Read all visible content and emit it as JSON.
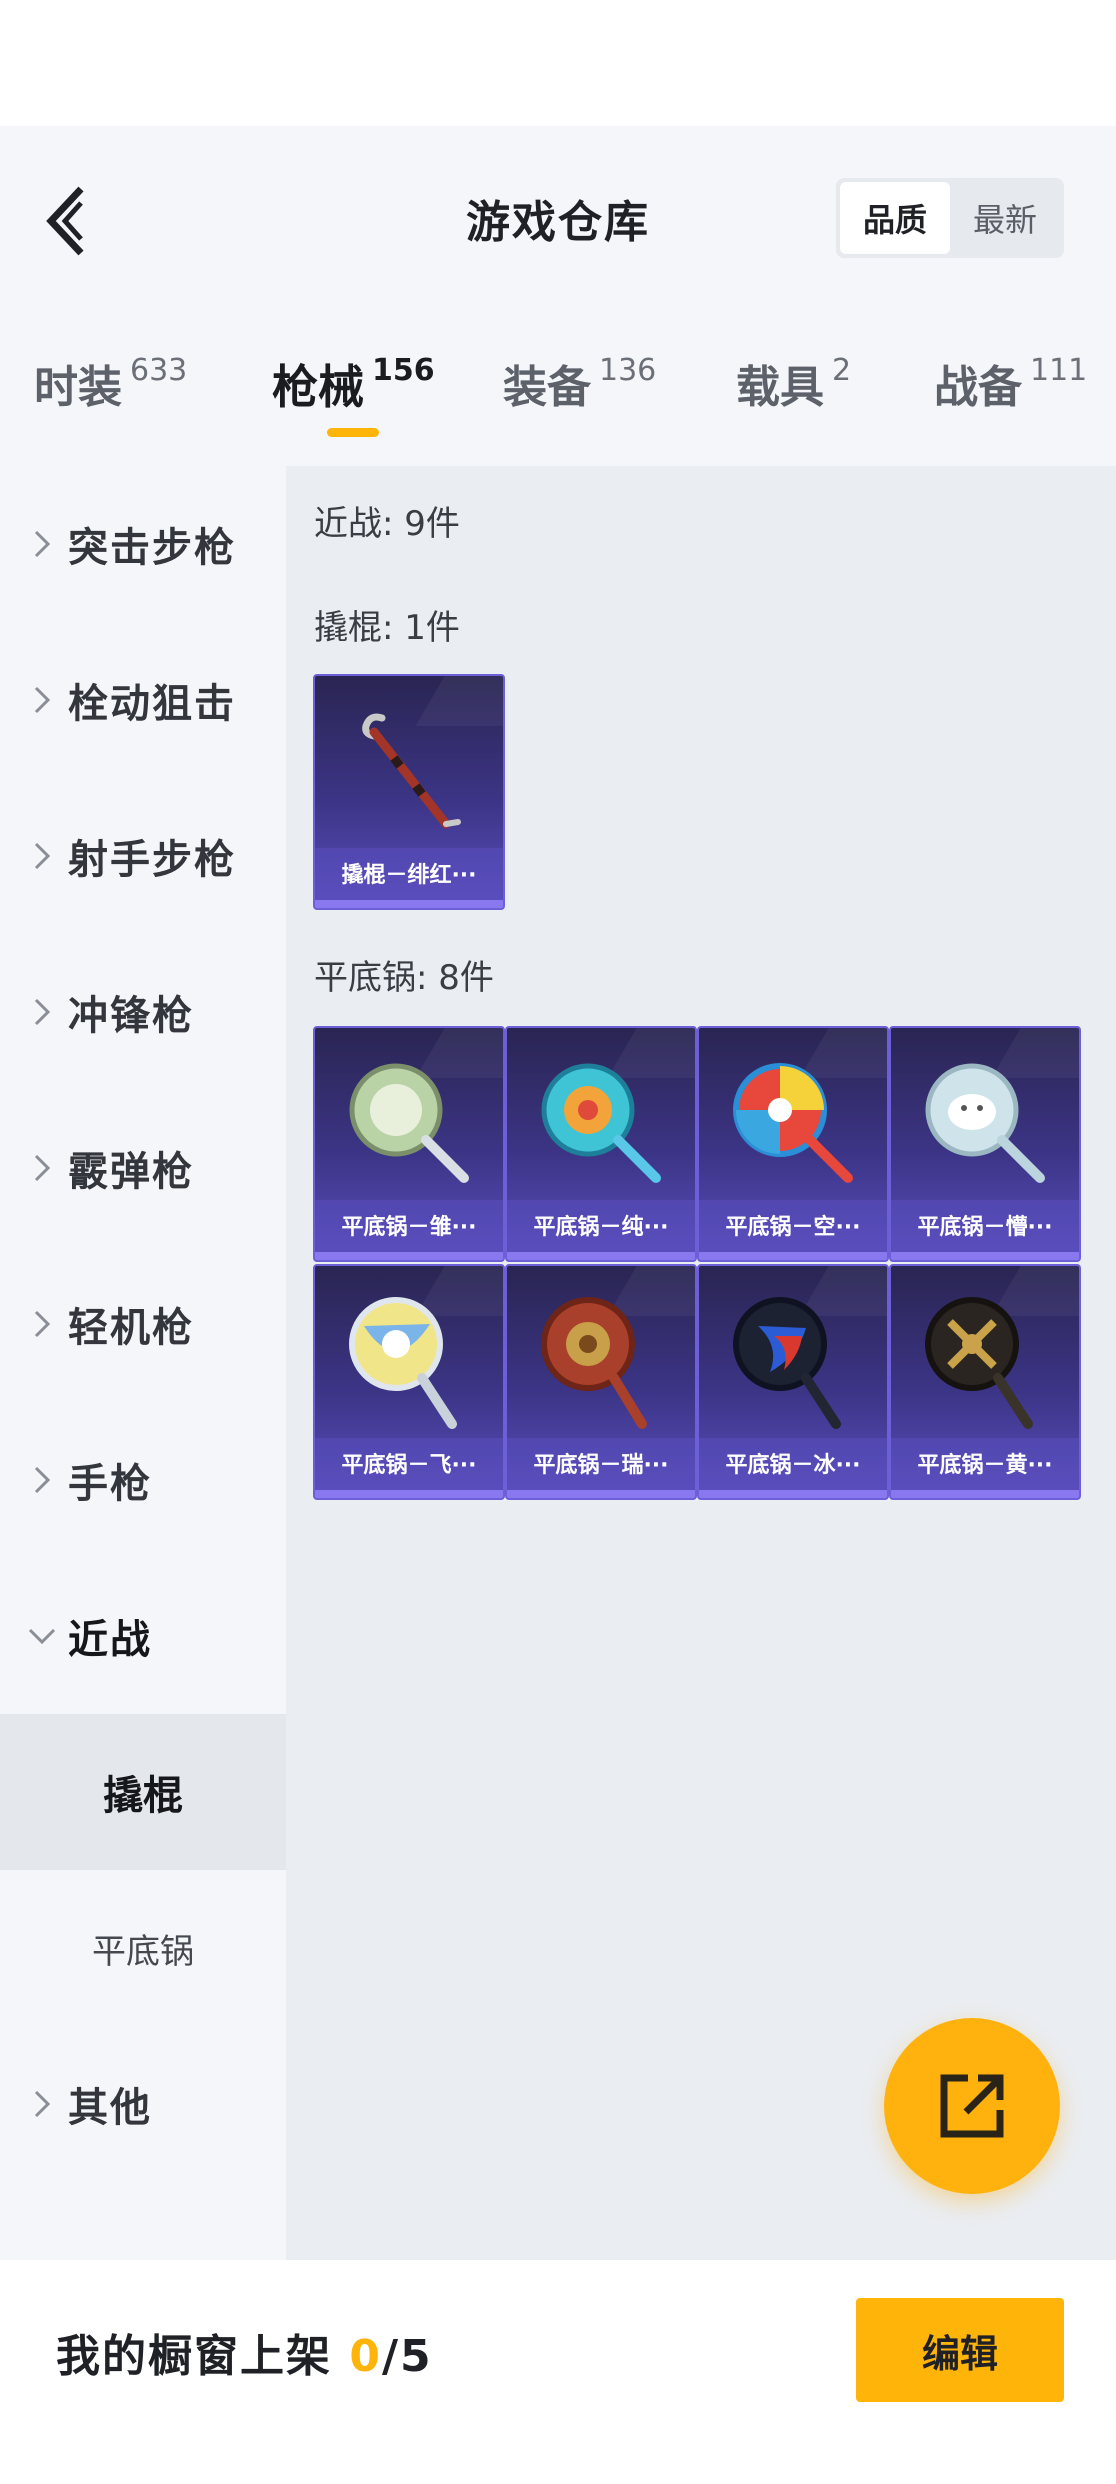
{
  "header": {
    "title": "游戏仓库",
    "sort_options": [
      "品质",
      "最新"
    ],
    "active_sort": "品质"
  },
  "tabs": [
    {
      "label": "时装",
      "count": "633"
    },
    {
      "label": "枪械",
      "count": "156"
    },
    {
      "label": "装备",
      "count": "136"
    },
    {
      "label": "载具",
      "count": "2"
    },
    {
      "label": "战备",
      "count": "111"
    }
  ],
  "active_tab": "枪械",
  "sidebar": {
    "items": [
      {
        "label": "突击步枪"
      },
      {
        "label": "栓动狙击"
      },
      {
        "label": "射手步枪"
      },
      {
        "label": "冲锋枪"
      },
      {
        "label": "霰弹枪"
      },
      {
        "label": "轻机枪"
      },
      {
        "label": "手枪"
      },
      {
        "label": "近战"
      }
    ],
    "expanded": "近战",
    "sub_items": [
      {
        "label": "撬棍"
      },
      {
        "label": "平底锅"
      }
    ],
    "selected_sub": "撬棍",
    "last_item": {
      "label": "其他"
    }
  },
  "content": {
    "section_title": "近战: 9件",
    "groups": [
      {
        "title": "撬棍: 1件",
        "items": [
          {
            "name": "撬棍－绯红···",
            "icon": "crowbar-icon",
            "color": "#b33a2e"
          }
        ]
      },
      {
        "title": "平底锅: 8件",
        "items": [
          {
            "name": "平底锅－雏···",
            "icon": "frying-pan-icon",
            "color": "#b9d3a6"
          },
          {
            "name": "平底锅－纯···",
            "icon": "frying-pan-icon",
            "color": "#3fc4d6"
          },
          {
            "name": "平底锅－空···",
            "icon": "frying-pan-icon",
            "color": "#e8473c"
          },
          {
            "name": "平底锅－懵···",
            "icon": "frying-pan-icon",
            "color": "#cfe3ea"
          },
          {
            "name": "平底锅－飞···",
            "icon": "frying-pan-icon",
            "color": "#f1e58a"
          },
          {
            "name": "平底锅－瑞···",
            "icon": "frying-pan-icon",
            "color": "#a8402b"
          },
          {
            "name": "平底锅－冰···",
            "icon": "frying-pan-icon",
            "color": "#2c5bd6"
          },
          {
            "name": "平底锅－黄···",
            "icon": "frying-pan-icon",
            "color": "#6b5a2a"
          }
        ]
      }
    ]
  },
  "fab": {
    "icon": "share-external-icon"
  },
  "bottom_bar": {
    "showcase_label": "我的橱窗上架 ",
    "showcase_used": "0",
    "showcase_total": "/5",
    "edit_label": "编辑"
  },
  "colors": {
    "accent": "#ffb40a",
    "card_start": "#2a2552",
    "card_end": "#5b4fbf"
  }
}
